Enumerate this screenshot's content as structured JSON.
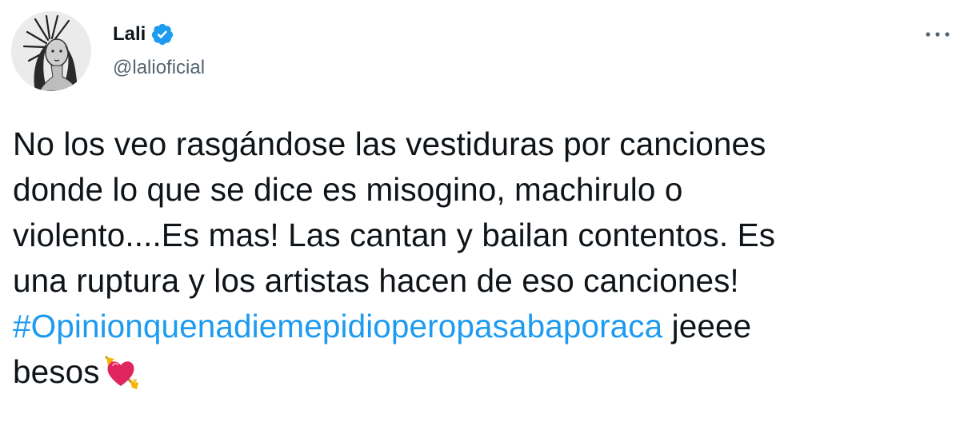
{
  "author": {
    "display_name": "Lali",
    "handle": "@lalioficial",
    "verified": true
  },
  "icons": {
    "verified": "verified-badge-icon",
    "more": "more-options-icon",
    "emoji": "heart-with-arrow-emoji"
  },
  "tweet": {
    "lines": [
      "No los veo rasgándose las vestiduras por canciones",
      "donde lo que se dice es misogino, machirulo o",
      "violento....Es mas! Las cantan y bailan contentos. Es",
      "una ruptura y los artistas hacen de eso canciones!"
    ],
    "hashtag": "#Opinionquenadiemepidioperopasabaporaca",
    "after_hashtag": " jeeee",
    "last_line": "besos"
  },
  "colors": {
    "text": "#0f1419",
    "secondary": "#536471",
    "link": "#1d9bf0",
    "verified": "#1d9bf0"
  }
}
